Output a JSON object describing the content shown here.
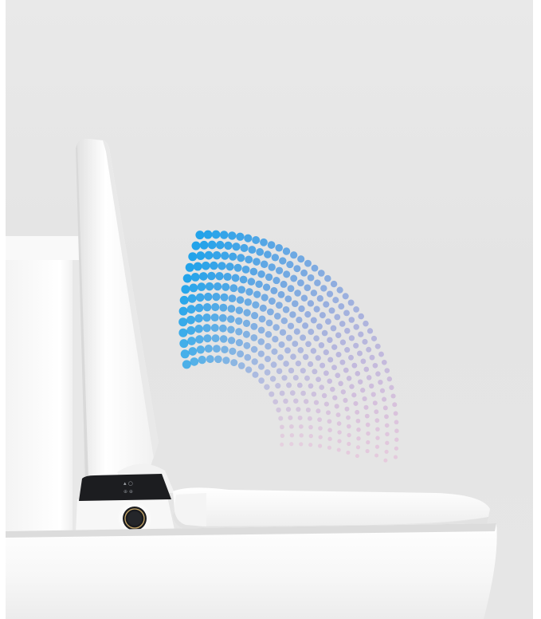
{
  "scene": {
    "subject": "smart-toilet-with-raised-lid",
    "control_panel_label": "",
    "knob_label": "",
    "colors": {
      "background": "#e6e6e6",
      "porcelain": "#f7f7f7",
      "panel": "#1c1d20",
      "wave_blue": "#22a3ea",
      "wave_pink": "#e79bcf"
    }
  }
}
